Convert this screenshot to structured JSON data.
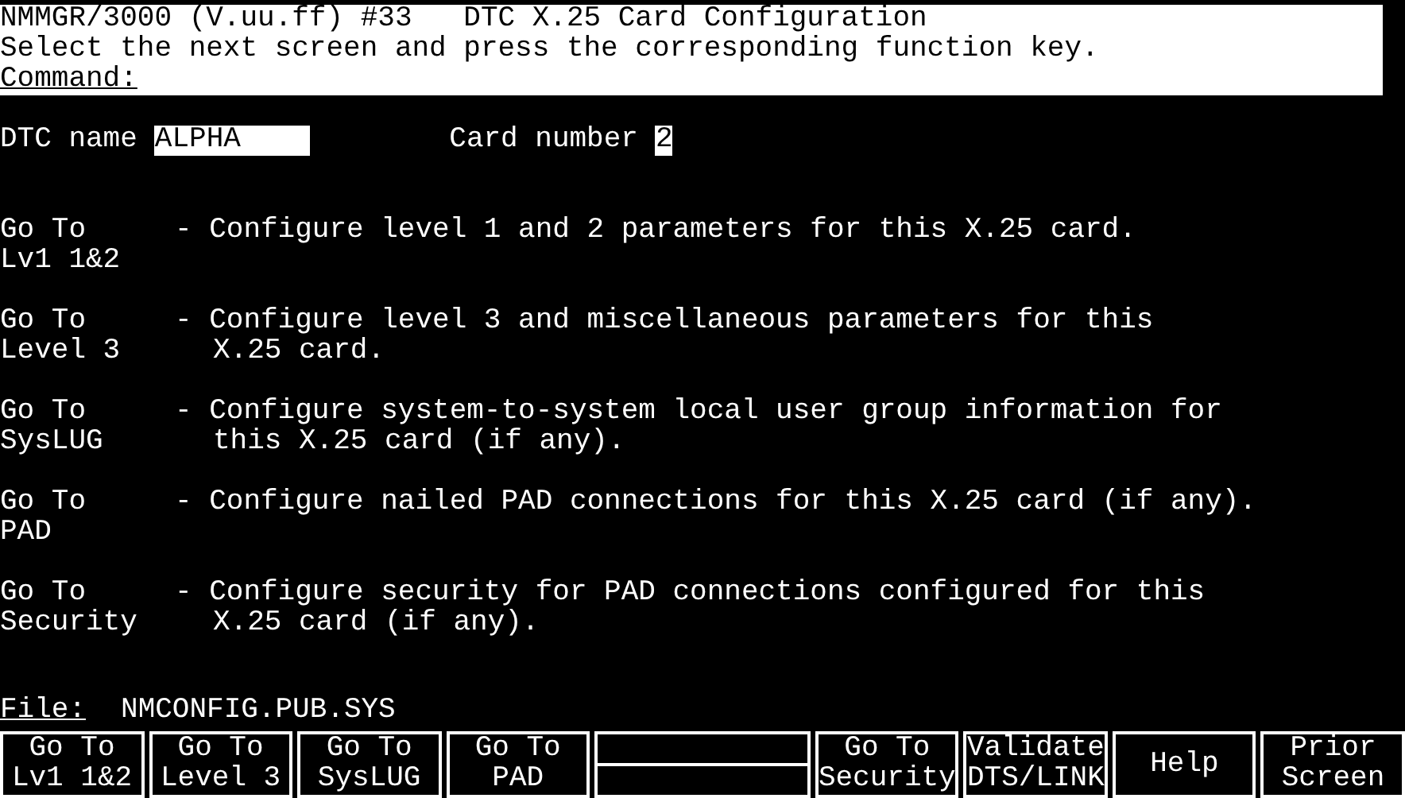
{
  "header": {
    "title": "NMMGR/3000 (V.uu.ff) #33   DTC X.25 Card Configuration",
    "instruction": "Select the next screen and press the corresponding function key.",
    "command_label": "Command:"
  },
  "fields": [
    {
      "label": "DTC name",
      "value": "ALPHA    "
    },
    {
      "label": "Card number",
      "value": "2"
    }
  ],
  "menu": [
    {
      "key_lines": [
        "Go To",
        "Lv1 1&2"
      ],
      "description_lines": [
        "- Configure level 1 and 2 parameters for this X.25 card."
      ]
    },
    {
      "key_lines": [
        "Go To",
        "Level 3"
      ],
      "description_lines": [
        "- Configure level 3 and miscellaneous parameters for this",
        "X.25 card."
      ]
    },
    {
      "key_lines": [
        "Go To",
        "SysLUG"
      ],
      "description_lines": [
        "- Configure system-to-system local user group information for",
        "this X.25 card (if any)."
      ]
    },
    {
      "key_lines": [
        "Go To",
        "PAD"
      ],
      "description_lines": [
        "- Configure nailed PAD connections for this X.25 card (if any)."
      ]
    },
    {
      "key_lines": [
        "Go To",
        "Security"
      ],
      "description_lines": [
        "- Configure security for PAD connections configured for this",
        "X.25 card (if any)."
      ]
    }
  ],
  "file": {
    "label": "File:",
    "value": "NMCONFIG.PUB.SYS"
  },
  "function_keys": [
    {
      "kind": "label",
      "lines": [
        "Go To",
        "Lv1 1&2"
      ]
    },
    {
      "kind": "label",
      "lines": [
        "Go To",
        "Level 3"
      ]
    },
    {
      "kind": "label",
      "lines": [
        "Go To",
        "SysLUG"
      ]
    },
    {
      "kind": "label",
      "lines": [
        "Go To",
        "PAD"
      ]
    },
    {
      "kind": "blank"
    },
    {
      "kind": "label",
      "lines": [
        "Go To",
        "Security"
      ]
    },
    {
      "kind": "label",
      "lines": [
        "Validate",
        "DTS/LINK"
      ]
    },
    {
      "kind": "label",
      "lines": [
        "Help"
      ]
    },
    {
      "kind": "label",
      "lines": [
        "Prior",
        "Screen"
      ]
    }
  ]
}
